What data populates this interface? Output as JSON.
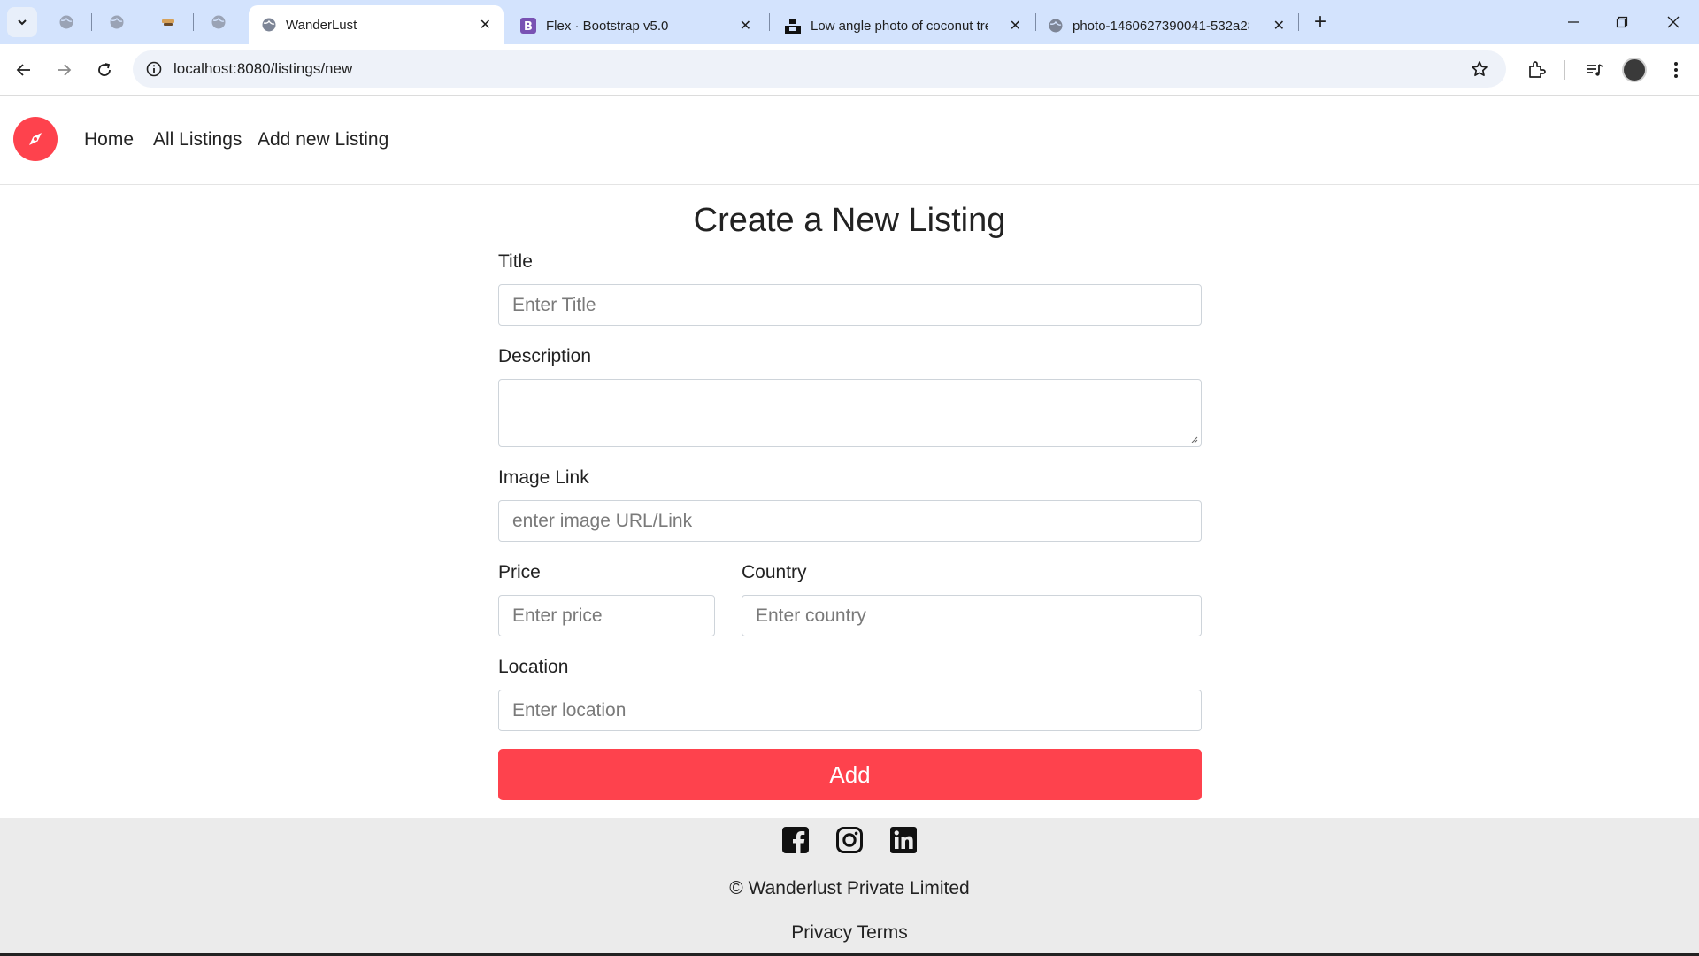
{
  "browser": {
    "tabs": [
      {
        "title": "WanderLust",
        "active": true
      },
      {
        "title": "Flex · Bootstrap v5.0",
        "active": false
      },
      {
        "title": "Low angle photo of coconut tre",
        "active": false
      },
      {
        "title": "photo-1460627390041-532a28",
        "active": false
      }
    ],
    "url": "localhost:8080/listings/new",
    "new_tab_symbol": "+",
    "close_symbol": "✕"
  },
  "navbar": {
    "links": [
      "Home",
      "All Listings",
      "Add new Listing"
    ]
  },
  "form": {
    "heading": "Create a New Listing",
    "title": {
      "label": "Title",
      "placeholder": "Enter Title"
    },
    "description": {
      "label": "Description"
    },
    "image": {
      "label": "Image Link",
      "placeholder": "enter image URL/Link"
    },
    "price": {
      "label": "Price",
      "placeholder": "Enter price"
    },
    "country": {
      "label": "Country",
      "placeholder": "Enter country"
    },
    "location": {
      "label": "Location",
      "placeholder": "Enter location"
    },
    "submit_label": "Add"
  },
  "footer": {
    "social_icons": [
      "facebook-icon",
      "instagram-icon",
      "linkedin-icon"
    ],
    "copyright": "© Wanderlust Private Limited",
    "links": "Privacy Terms"
  },
  "colors": {
    "brand": "#fe424d",
    "tabstrip": "#d3e3fd",
    "footer": "#ebebeb"
  }
}
